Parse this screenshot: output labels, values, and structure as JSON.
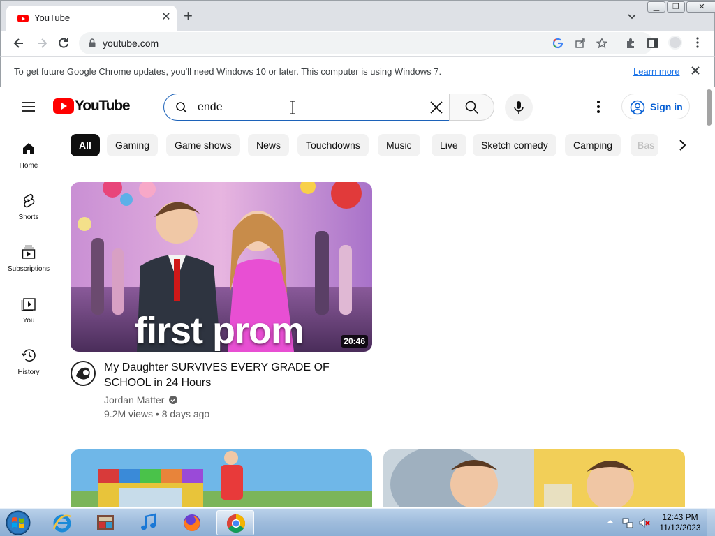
{
  "browser": {
    "tab_title": "YouTube",
    "url": "youtube.com",
    "infobar_text": "To get future Google Chrome updates, you'll need Windows 10 or later. This computer is using Windows 7.",
    "infobar_link": "Learn more"
  },
  "youtube": {
    "logo_text": "YouTube",
    "search_value": "ende",
    "signin_label": "Sign in",
    "sidenav": [
      {
        "label": "Home",
        "icon": "home-icon"
      },
      {
        "label": "Shorts",
        "icon": "shorts-icon"
      },
      {
        "label": "Subscriptions",
        "icon": "subscriptions-icon"
      },
      {
        "label": "You",
        "icon": "you-icon"
      },
      {
        "label": "History",
        "icon": "history-icon"
      }
    ],
    "chips": [
      "All",
      "Gaming",
      "Game shows",
      "News",
      "Touchdowns",
      "Music",
      "Live",
      "Sketch comedy",
      "Camping",
      "Bas"
    ],
    "active_chip": "All",
    "video": {
      "thumbnail_caption": "first prom",
      "duration": "20:46",
      "title": "My Daughter SURVIVES EVERY GRADE OF SCHOOL in 24 Hours",
      "channel": "Jordan Matter",
      "meta": "9.2M views • 8 days ago"
    },
    "accent": "#ff0000",
    "link_color": "#065fd4"
  },
  "taskbar": {
    "apps": [
      "start-orb",
      "internet-explorer-icon",
      "media-center-icon",
      "itunes-icon",
      "firefox-icon",
      "chrome-icon"
    ],
    "time": "12:43 PM",
    "date": "11/12/2023"
  }
}
